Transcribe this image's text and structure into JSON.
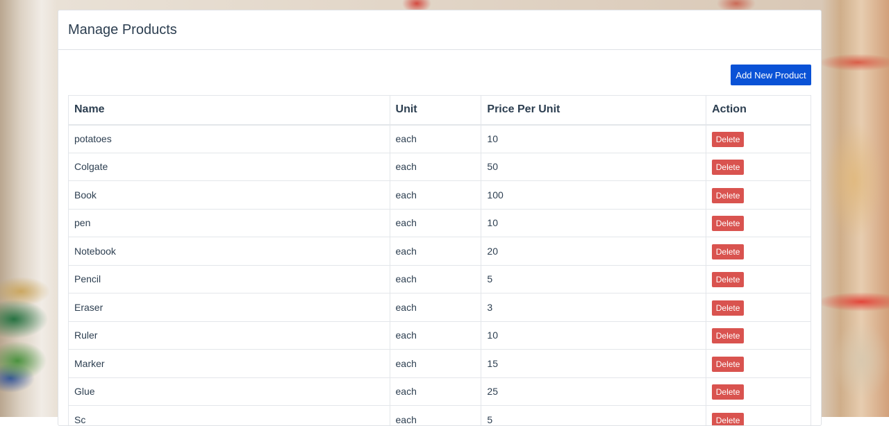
{
  "page": {
    "title": "Manage Products"
  },
  "toolbar": {
    "add_label": "Add New Product"
  },
  "table": {
    "headers": {
      "name": "Name",
      "unit": "Unit",
      "price": "Price Per Unit",
      "action": "Action"
    },
    "rows": [
      {
        "name": "potatoes",
        "unit": "each",
        "price": "10",
        "action": "Delete"
      },
      {
        "name": "Colgate",
        "unit": "each",
        "price": "50",
        "action": "Delete"
      },
      {
        "name": "Book",
        "unit": "each",
        "price": "100",
        "action": "Delete"
      },
      {
        "name": "pen",
        "unit": "each",
        "price": "10",
        "action": "Delete"
      },
      {
        "name": "Notebook",
        "unit": "each",
        "price": "20",
        "action": "Delete"
      },
      {
        "name": "Pencil",
        "unit": "each",
        "price": "5",
        "action": "Delete"
      },
      {
        "name": "Eraser",
        "unit": "each",
        "price": "3",
        "action": "Delete"
      },
      {
        "name": "Ruler",
        "unit": "each",
        "price": "10",
        "action": "Delete"
      },
      {
        "name": "Marker",
        "unit": "each",
        "price": "15",
        "action": "Delete"
      },
      {
        "name": "Glue",
        "unit": "each",
        "price": "25",
        "action": "Delete"
      },
      {
        "name": "Sc",
        "unit": "each",
        "price": "5",
        "action": "Delete"
      }
    ]
  },
  "colors": {
    "primary_button": "#0a52d6",
    "danger_button": "#d9534f",
    "text": "#2c3e50"
  }
}
